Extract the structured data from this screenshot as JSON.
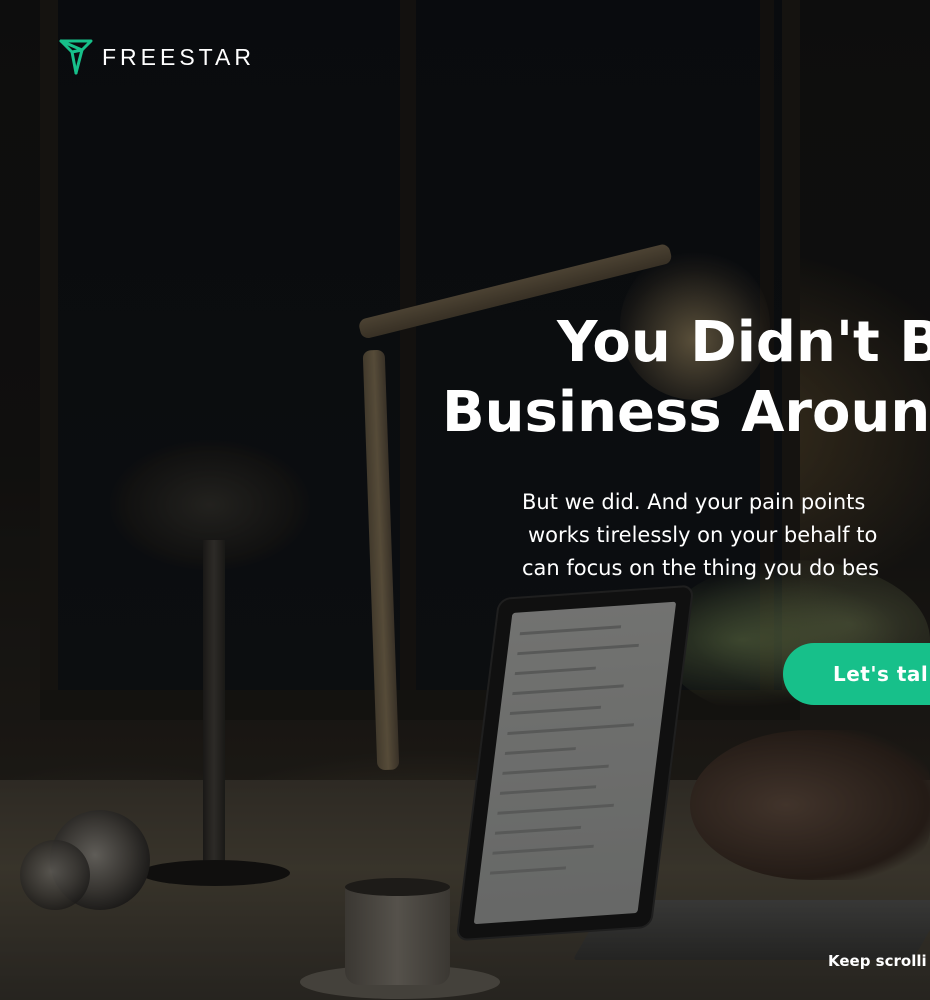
{
  "brand": {
    "name": "FREESTAR",
    "accent_color": "#17c08a",
    "logo_icon": "freestar-logo-icon"
  },
  "hero": {
    "headline_line1": "You Didn't B",
    "headline_line2": "Business Around",
    "body_line1": "But we did. And your pain points",
    "body_line2": "works tirelessly on your behalf to",
    "body_line3": "can focus on the thing you do bes",
    "cta_label": "Let's tal",
    "scroll_hint": "Keep scrolli"
  }
}
